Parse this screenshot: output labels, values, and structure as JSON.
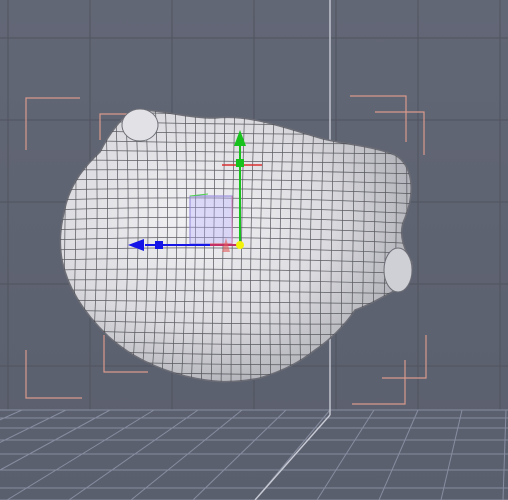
{
  "app": {
    "viewport_label": ""
  },
  "scene": {
    "background_color": "#5f6472",
    "grid_color": "#4e5360",
    "floor_grid_color": "#818799",
    "center_axis_color": "#c9ccd6",
    "safe_frame_color": "#d99a8a",
    "mesh_fill": "#d9d9dd",
    "mesh_wire": "#4a4a50"
  },
  "gizmo": {
    "x_axis_color": "#ff2a2a",
    "y_axis_color": "#18c21c",
    "z_axis_color": "#1212e6",
    "center_handle_color": "#f2f20a",
    "plane_handle_color": "#b5a8ff",
    "icons": [
      "move-gizmo-x-arrow-icon",
      "move-gizmo-y-arrow-icon",
      "move-gizmo-z-arrow-icon"
    ]
  }
}
